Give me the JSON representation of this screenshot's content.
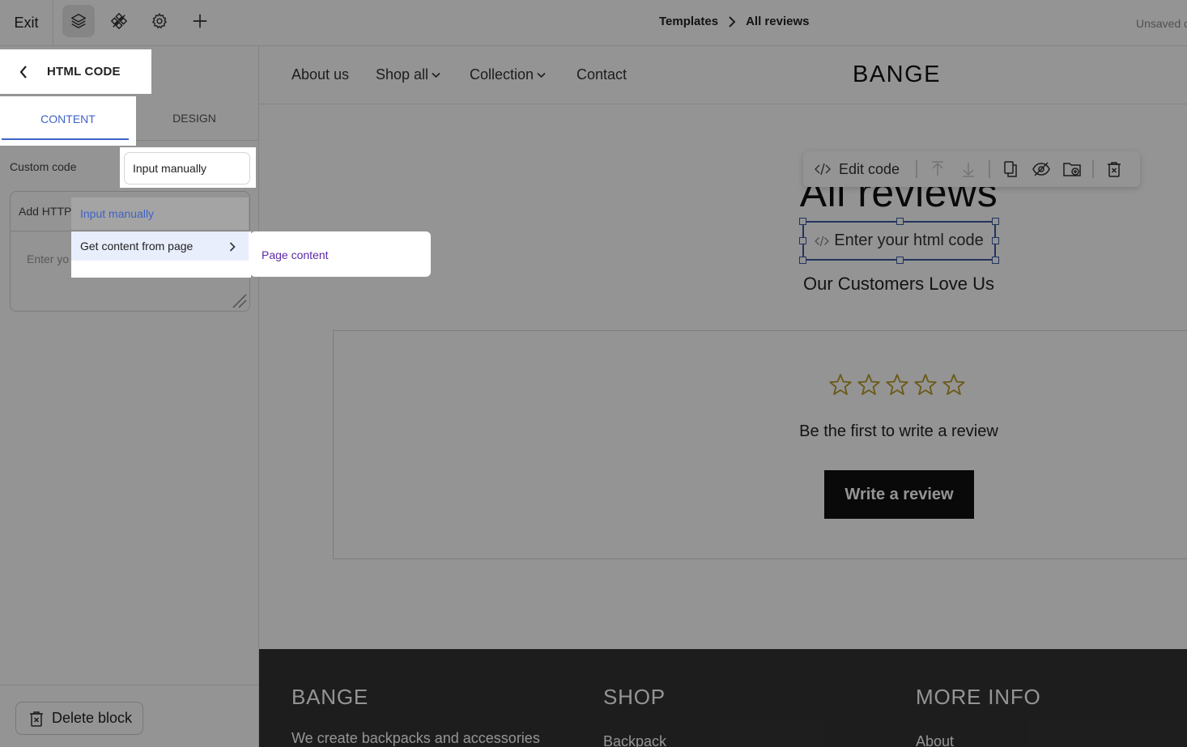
{
  "topbar": {
    "exit_label": "Exit",
    "breadcrumb": {
      "parent": "Templates",
      "current": "All reviews"
    },
    "status": "Unsaved c"
  },
  "panel": {
    "title": "HTML CODE",
    "tabs": {
      "content": "CONTENT",
      "design": "DESIGN"
    },
    "custom_code_label": "Custom code",
    "source_select_value": "Input manually",
    "textarea_header": "Add HTTP",
    "textarea_placeholder": "Enter yo",
    "delete_label": "Delete block"
  },
  "dropdown": {
    "options": [
      "Input manually",
      "Get content from page"
    ],
    "submenu_options": [
      "Page content"
    ]
  },
  "site": {
    "nav": [
      "About us",
      "Shop all",
      "Collection",
      "Contact"
    ],
    "brand": "BANGE",
    "toolbar_edit_label": "Edit code",
    "heading": "All reviews",
    "html_placeholder": "Enter your html code",
    "subheading": "Our Customers Love Us",
    "rating": 0,
    "rating_max": 5,
    "review_prompt": "Be the first to write a review",
    "write_button": "Write a review",
    "footer": {
      "col1_title": "BANGE",
      "col1_text": "We create backpacks and accessories",
      "col2_title": "SHOP",
      "col2_link": "Backpack",
      "col3_title": "MORE INFO",
      "col3_link": "About"
    }
  },
  "colors": {
    "accent": "#3f63c7",
    "selection": "#3c5aa0",
    "star": "#b89b2b",
    "footer_bg": "#333333",
    "submenu_text": "#5b2aa8"
  }
}
